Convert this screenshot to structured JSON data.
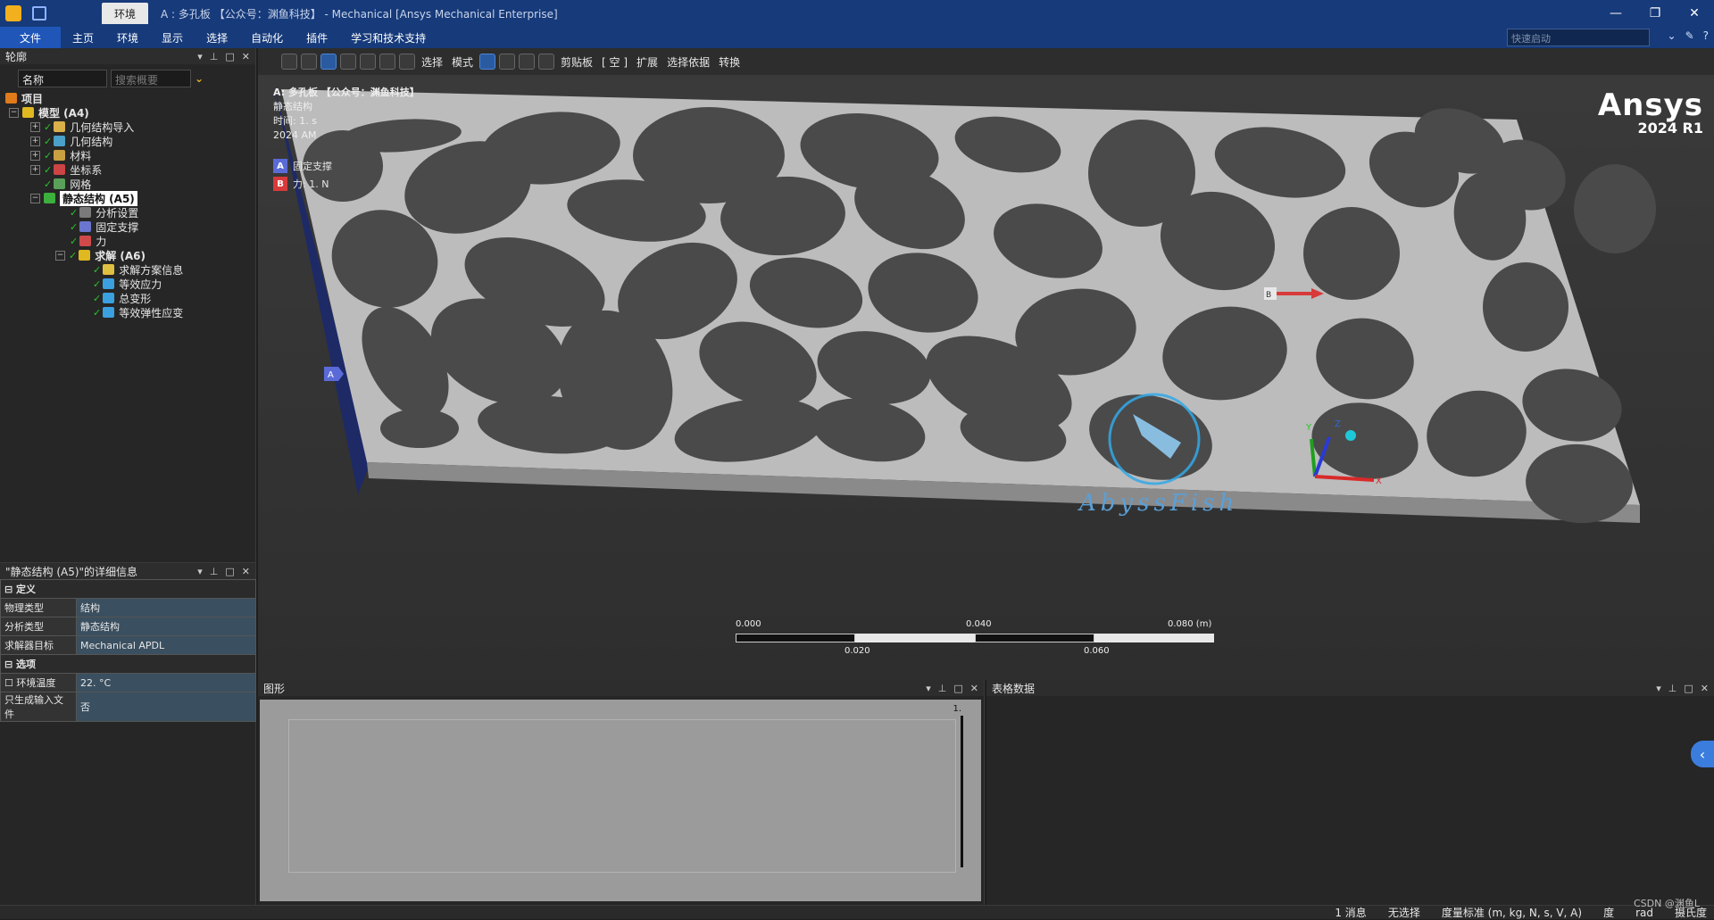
{
  "titlebar": {
    "context_tab": "环境",
    "title": "A : 多孔板 【公众号：渊鱼科技】 - Mechanical [Ansys Mechanical Enterprise]",
    "minimize": "—",
    "restore": "❐",
    "close": "✕"
  },
  "ribbon": {
    "tabs": [
      "文件",
      "主页",
      "环境",
      "显示",
      "选择",
      "自动化",
      "插件",
      "学习和技术支持"
    ],
    "quick_search_placeholder": "快速启动"
  },
  "outline": {
    "title": "轮廓",
    "name_filter": "名称",
    "search_placeholder": "搜索概要",
    "tree": [
      {
        "label": "项目",
        "level": 0
      },
      {
        "label": "模型 (A4)",
        "level": 1
      },
      {
        "label": "几何结构导入",
        "level": 2
      },
      {
        "label": "几何结构",
        "level": 2
      },
      {
        "label": "材料",
        "level": 2
      },
      {
        "label": "坐标系",
        "level": 2
      },
      {
        "label": "网格",
        "level": 2
      },
      {
        "label": "静态结构 (A5)",
        "level": 2
      },
      {
        "label": "分析设置",
        "level": 3
      },
      {
        "label": "固定支撑",
        "level": 3
      },
      {
        "label": "力",
        "level": 3
      },
      {
        "label": "求解 (A6)",
        "level": 3
      },
      {
        "label": "求解方案信息",
        "level": 4
      },
      {
        "label": "等效应力",
        "level": 4
      },
      {
        "label": "总变形",
        "level": 4
      },
      {
        "label": "等效弹性应变",
        "level": 4
      }
    ]
  },
  "details": {
    "title": "\"静态结构 (A5)\"的详细信息",
    "sections": [
      {
        "name": "定义",
        "rows": [
          {
            "key": "物理类型",
            "value": "结构"
          },
          {
            "key": "分析类型",
            "value": "静态结构"
          },
          {
            "key": "求解器目标",
            "value": "Mechanical APDL"
          }
        ]
      },
      {
        "name": "选项",
        "rows": [
          {
            "key": "环境温度",
            "value": "22. °C"
          },
          {
            "key": "只生成输入文件",
            "value": "否"
          }
        ]
      }
    ]
  },
  "toolbar": {
    "select_label": "选择",
    "mode_label": "模式",
    "clipboard_label": "剪贴板",
    "empty_label": "[ 空 ]",
    "extend_label": "扩展",
    "select_by_label": "选择依据",
    "convert_label": "转换"
  },
  "viewport": {
    "model_title": "A: 多孔板 【公众号：渊鱼科技】",
    "analysis": "静态结构",
    "time": "时间: 1. s",
    "date": "2024 AM",
    "legend": [
      {
        "tag": "A",
        "label": "固定支撑",
        "color": "#5a6bd8"
      },
      {
        "tag": "B",
        "label": "力: 1. N",
        "color": "#d83a3a"
      }
    ],
    "brand_logo": "Ansys",
    "brand_version": "2024 R1",
    "scale_labels_top": [
      "0.000",
      "0.040",
      "0.080 (m)"
    ],
    "scale_labels_bottom": [
      "0.020",
      "0.060"
    ],
    "support_marker": "A",
    "force_marker": "B",
    "watermark": "AbyssFish",
    "triad_y": "Y",
    "triad_z": "Z",
    "triad_x": "X"
  },
  "graph": {
    "title": "图形",
    "marker": "1."
  },
  "tabular": {
    "title": "表格数据"
  },
  "statusbar": {
    "messages": "1 消息",
    "selection": "无选择",
    "units": "度量标准 (m, kg, N, s, V, A)",
    "angle": "度",
    "rad": "rad",
    "temp": "摄氏度"
  },
  "watermark_corner": "CSDN @渊鱼L"
}
